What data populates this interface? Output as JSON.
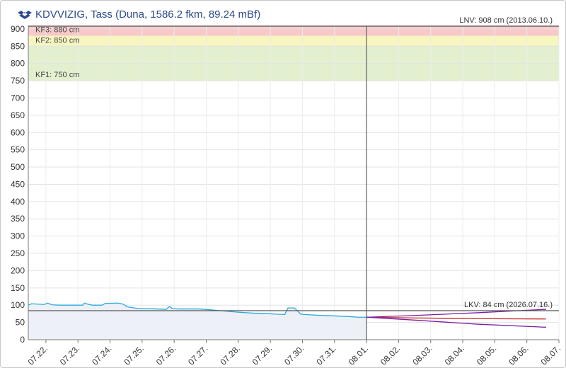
{
  "header": {
    "title": "KDVVIZIG, Tass (Duna, 1586.2 fkm, 89.24 mBf)",
    "logo_icon": "kdvvizig-wave-logo-icon"
  },
  "colors": {
    "measured": "#29a9d8",
    "forecast_mid": "#c62828",
    "forecast_band": "#7b1fa2",
    "band_kf3": "#f9c8c8",
    "band_kf2": "#f7f5c0",
    "band_kf1": "#e2f0cf",
    "under_fill": "#eef0f7",
    "title": "#2b4a8b"
  },
  "chart_data": {
    "type": "line",
    "ylim": [
      0,
      910
    ],
    "yticks": [
      0,
      50,
      100,
      150,
      200,
      250,
      300,
      350,
      400,
      450,
      500,
      550,
      600,
      650,
      700,
      750,
      800,
      850,
      900
    ],
    "xlim": [
      0,
      16.55
    ],
    "xtick_labels": [
      "07.22.",
      "07.23.",
      "07.24.",
      "07.25.",
      "07.26.",
      "07.27.",
      "07.28.",
      "07.29.",
      "07.30.",
      "07.31.",
      "08.01.",
      "08.02.",
      "08.03.",
      "08.04.",
      "08.05.",
      "08.06.",
      "08.07."
    ],
    "bands": [
      {
        "label": "KF3: 880 cm",
        "from": 880,
        "to": 910,
        "color": "#f9c8c8"
      },
      {
        "label": "KF2: 850 cm",
        "from": 850,
        "to": 880,
        "color": "#f7f5c0"
      },
      {
        "label": "KF1: 750 cm",
        "from": 750,
        "to": 850,
        "color": "#e2f0cf"
      }
    ],
    "lnv": {
      "label": "LNV: 908 cm (2013.06.10.)",
      "value": 908
    },
    "lkv": {
      "label": "LKV: 84 cm (2026.07.16.)",
      "value": 84
    },
    "now_x": 10.55,
    "measured": {
      "x": [
        0,
        0.1,
        0.3,
        0.5,
        0.6,
        0.75,
        1,
        1.2,
        1.5,
        1.7,
        1.75,
        1.85,
        2,
        2.3,
        2.4,
        2.8,
        2.95,
        3.1,
        3.3,
        3.5,
        3.8,
        4,
        4.3,
        4.4,
        4.5,
        4.7,
        5,
        5.3,
        5.5,
        6,
        6.5,
        7,
        7.4,
        7.7,
        8,
        8.1,
        8.3,
        8.5,
        8.6,
        9,
        9.5,
        10,
        10.3,
        10.55
      ],
      "y": [
        100,
        104,
        103,
        102,
        106,
        101,
        100,
        100,
        100,
        100,
        106,
        103,
        100,
        100,
        105,
        106,
        103,
        95,
        92,
        90,
        90,
        89,
        88,
        96,
        90,
        89,
        89,
        89,
        88,
        84,
        80,
        77,
        76,
        74,
        73,
        92,
        92,
        74,
        73,
        71,
        69,
        67,
        65,
        65
      ]
    },
    "forecast": [
      {
        "x": [
          10.55,
          12,
          14,
          16.15
        ],
        "y": [
          65,
          63,
          61,
          60
        ],
        "color": "#c62828"
      },
      {
        "x": [
          10.55,
          12,
          14,
          16.15
        ],
        "y": [
          65,
          70,
          78,
          88
        ],
        "color": "#7b1fa2"
      },
      {
        "x": [
          10.55,
          12,
          14,
          16.15
        ],
        "y": [
          65,
          57,
          45,
          36
        ],
        "color": "#7b1fa2"
      }
    ]
  }
}
